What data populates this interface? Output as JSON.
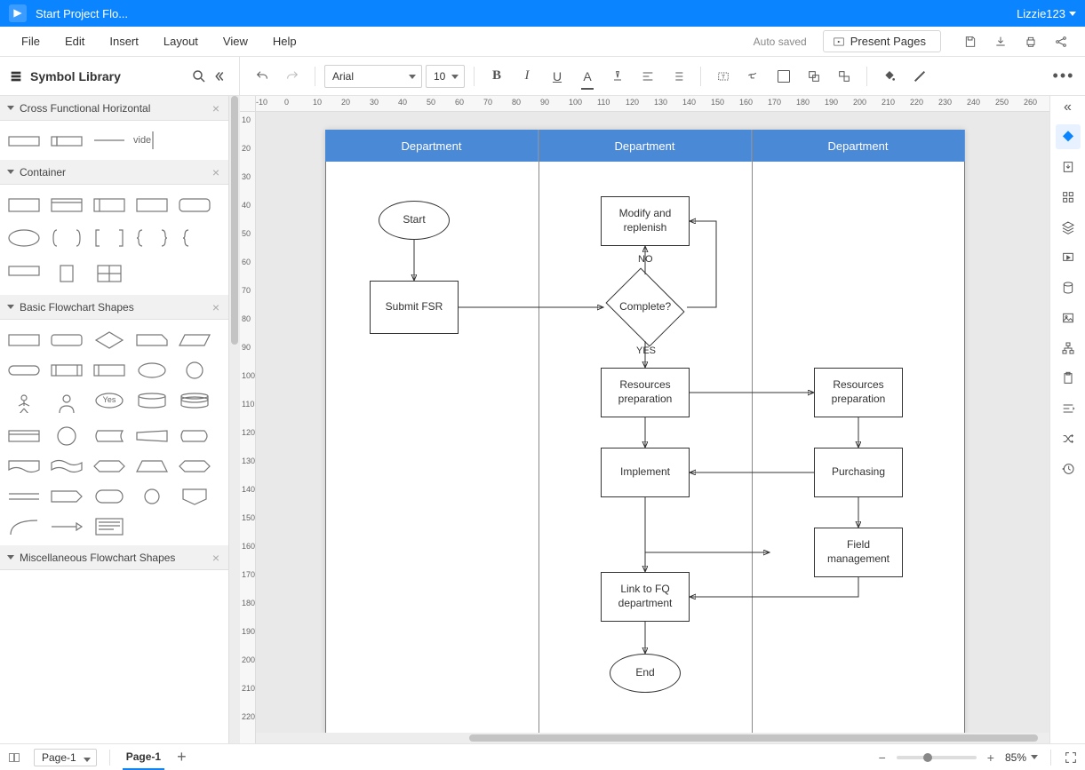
{
  "title_bar": {
    "doc_title": "Start Project Flo...",
    "user": "Lizzie123"
  },
  "menu": {
    "file": "File",
    "edit": "Edit",
    "insert": "Insert",
    "layout": "Layout",
    "view": "View",
    "help": "Help",
    "autosaved": "Auto saved",
    "present": "Present Pages"
  },
  "sidebar": {
    "header": "Symbol Library",
    "sections": {
      "cfh": "Cross Functional Horizontal",
      "container": "Container",
      "basic": "Basic Flowchart Shapes",
      "misc": "Miscellaneous Flowchart Shapes"
    },
    "cfh_vide": "vide"
  },
  "toolbar": {
    "font": "Arial",
    "size": "10"
  },
  "ruler_h": [
    "-10",
    "0",
    "10",
    "20",
    "30",
    "40",
    "50",
    "60",
    "70",
    "80",
    "90",
    "100",
    "110",
    "120",
    "130",
    "140",
    "150",
    "160",
    "170",
    "180",
    "190",
    "200",
    "210",
    "220",
    "230",
    "240",
    "250",
    "260"
  ],
  "ruler_v": [
    "10",
    "20",
    "30",
    "40",
    "50",
    "60",
    "70",
    "80",
    "90",
    "100",
    "110",
    "120",
    "130",
    "140",
    "150",
    "160",
    "170",
    "180",
    "190",
    "200",
    "210",
    "220"
  ],
  "swimlanes": [
    "Department",
    "Department",
    "Department"
  ],
  "nodes": {
    "start": "Start",
    "submit": "Submit FSR",
    "modify": "Modify and replenish",
    "complete": "Complete?",
    "no": "NO",
    "yes": "YES",
    "resprep1": "Resources preparation",
    "resprep2": "Resources preparation",
    "implement": "Implement",
    "purchasing": "Purchasing",
    "fieldmgmt": "Field management",
    "linkfq": "Link to FQ department",
    "end": "End"
  },
  "shape_yes": "Yes",
  "status": {
    "page_sel": "Page-1",
    "tab": "Page-1",
    "zoom": "85%"
  }
}
